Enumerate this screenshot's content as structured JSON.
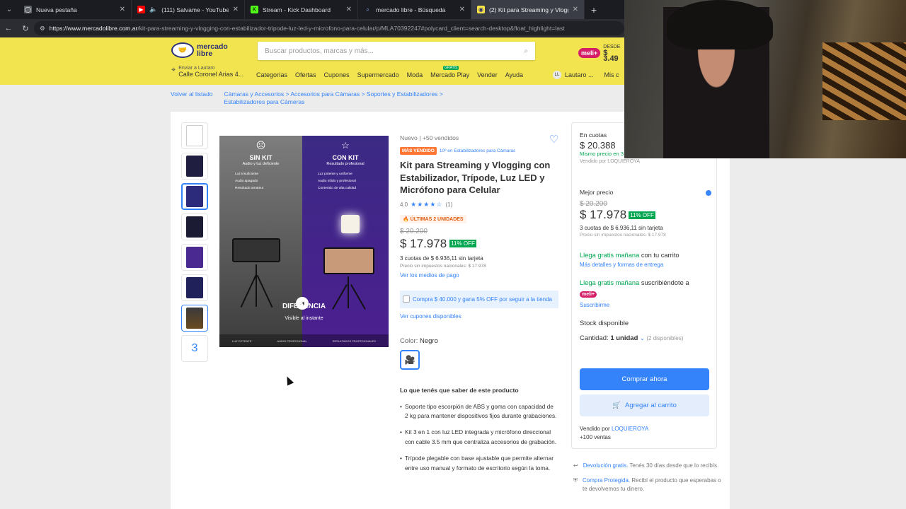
{
  "tabs": [
    {
      "title": "Nueva pestaña",
      "icon": "globe-icon",
      "color": "#5f6368"
    },
    {
      "title": "(111) Salvame - YouTube",
      "icon": "youtube-icon",
      "color": "#ff0000"
    },
    {
      "title": "Stream - Kick Dashboard",
      "icon": "kick-icon",
      "color": "#53fc18"
    },
    {
      "title": "mercado libre - Búsqueda",
      "icon": "search-icon",
      "color": "#8ab4f8"
    },
    {
      "title": "(2) Kit para Streaming y Vlogging",
      "icon": "mercadolibre-icon",
      "color": "#f7e348"
    }
  ],
  "address": {
    "host": "https://www.mercadolibre.com.ar",
    "path": "/kit-para-streaming-y-vlogging-con-estabilizador-tripode-luz-led-y-microfono-para-celular/p/MLA70392247#polycard_client=search-desktop&float_highlight=last"
  },
  "header": {
    "logo_line1": "mercado",
    "logo_line2": "libre",
    "search_placeholder": "Buscar productos, marcas y más...",
    "promo_badge": "meli+",
    "promo_top": "DESDE",
    "promo_price": "$ 3.49",
    "ship_to": "Enviar a Lautaro",
    "address": "Calle Coronel Arias 4...",
    "menu": [
      "Categorías",
      "Ofertas",
      "Cupones",
      "Supermercado",
      "Moda",
      "Mercado Play",
      "Vender",
      "Ayuda"
    ],
    "menu_new": "GRATIS",
    "user_initials": "LL",
    "user_name": "Lautaro ...",
    "user_extra": "Mis c"
  },
  "breadcrumb": {
    "back": "Volver al listado",
    "path": "Cámaras y Accesorios  >  Accesorios para Cámaras  >  Soportes y Estabilizadores  >  Estabilizadores para Cámeras"
  },
  "gallery": {
    "more_count": "3"
  },
  "image": {
    "left_title": "SIN KIT",
    "left_sub": "Audio y luz deficiente",
    "left_items": [
      "Luz insuficiente",
      "Audio apagado",
      "Resultado amateur"
    ],
    "right_title": "CON KIT",
    "right_sub": "Resultado profesional",
    "right_items": [
      "Luz potente y uniforme",
      "Audio nítido y profesional",
      "Contenido de alta calidad"
    ],
    "footer_title": "DIFERENCIA",
    "footer_sub": "Visible al instante",
    "bar_items": [
      "LUZ POTENTE",
      "AUDIO PROFESIONAL",
      "RESULTADOS PROFESIONALES"
    ]
  },
  "product": {
    "condition": "Nuevo  |  +50 vendidos",
    "badge": "MÁS VENDIDO",
    "rank": "10º en Estabilizadores para Cámaras",
    "title": "Kit para Streaming y Vlogging con Estabilizador, Trípode, Luz LED y Micrófono para Celular",
    "rating": "4.0",
    "rating_value": 4,
    "reviews": "(1)",
    "last_units": "ÚLTIMAS 2 UNIDADES",
    "old_price": "$ 20.200",
    "price": "$ 17.978",
    "discount": "11% OFF",
    "installments": "3 cuotas de $ 6.936,11 sin tarjeta",
    "tax": "Precio sin impuestos nacionales: $ 17.978",
    "payment_link": "Ver los medios de pago",
    "coupon": "Compra $ 40.000 y gana 5% OFF por seguir a la tienda",
    "coupons_link": "Ver cupones disponibles",
    "color_label": "Color:",
    "color_value": "Negro",
    "know_title": "Lo que tenés que saber de este producto",
    "features": [
      "Soporte tipo escorpión de ABS y goma con capacidad de 2 kg para mantener dispositivos fijos durante grabaciones.",
      "Kit 3 en 1 con luz LED integrada y micrófono direccional con cable 3.5 mm que centraliza accesorios de grabación.",
      "Trípode plegable con base ajustable que permite alternar entre uso manual y formato de escritorio según la toma."
    ]
  },
  "buybox": {
    "cuotas_label": "En cuotas",
    "cuotas_price": "$ 20.388",
    "cuotas_note": "Mismo precio en 3 cuotas de $ 6.796 sin ...",
    "cuotas_seller": "Vendido por LOQUIEROYA",
    "best_label": "Mejor precio",
    "best_old": "$ 20.200",
    "best_price": "$ 17.978",
    "best_off": "11% OFF",
    "best_inst": "3 cuotas de $ 6.936,11 sin tarjeta",
    "best_tax": "Precio sin impuestos nacionales: $ 17.978",
    "ship1_green": "Llega gratis mañana",
    "ship1_rest": " con tu carrito",
    "ship1_link": "Más detalles y formas de entrega",
    "ship2_green": "Llega gratis mañana",
    "ship2_rest": " suscribiéndote a",
    "ship2_badge": "meli+",
    "ship2_link": "Suscribirme",
    "stock": "Stock disponible",
    "qty_label": "Cantidad:",
    "qty_value": "1 unidad",
    "qty_avail": "(2 disponibles)",
    "buy_now": "Comprar ahora",
    "add_cart": "Agregar al carrito",
    "sold_by": "Vendido por ",
    "seller": "LOQUIEROYA",
    "sales": "+100 ventas"
  },
  "benefits": [
    {
      "link": "Devolución gratis.",
      "text": " Tenés 30 días desde que lo recibís."
    },
    {
      "link": "Compra Protegida.",
      "text": " Recibí el producto que esperabas o te devolvemos tu dinero."
    }
  ],
  "colors": {
    "accent": "#3483fa",
    "brand_yellow": "#f2e44f",
    "green": "#00a650"
  }
}
